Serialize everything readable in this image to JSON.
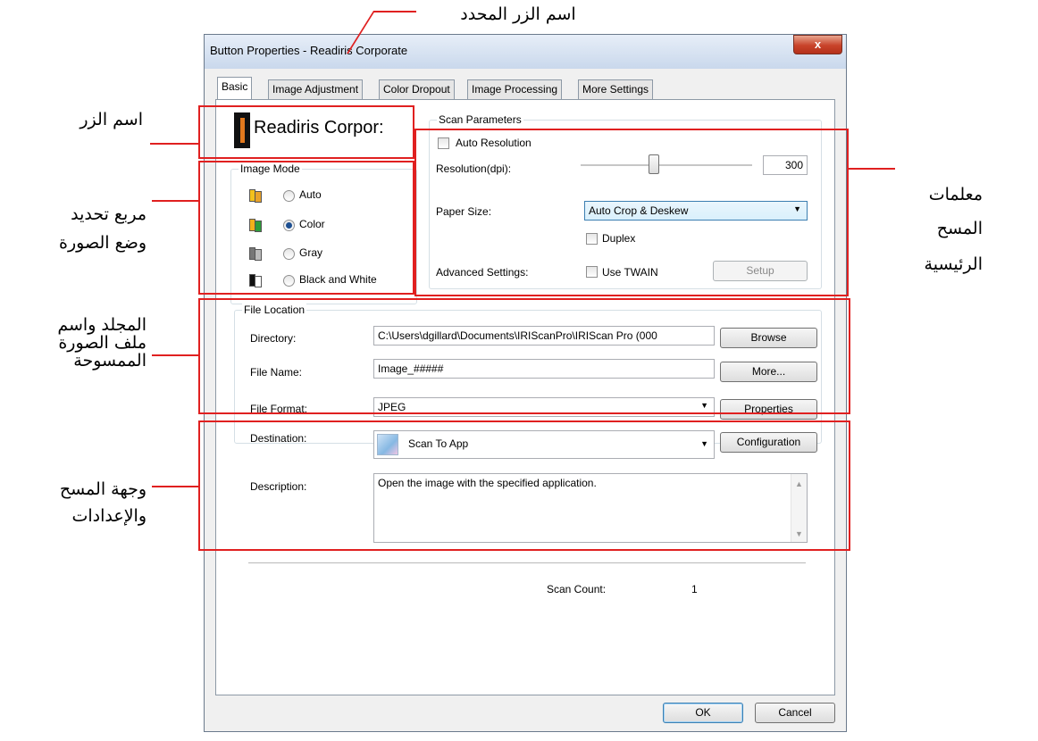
{
  "window": {
    "title": "Button Properties - Readiris Corporate",
    "close_label": "x"
  },
  "tabs": [
    {
      "label": "Basic"
    },
    {
      "label": "Image Adjustment"
    },
    {
      "label": "Color Dropout"
    },
    {
      "label": "Image Processing"
    },
    {
      "label": "More Settings"
    }
  ],
  "button_name": "Readiris Corpor:",
  "image_mode": {
    "legend": "Image Mode",
    "options": [
      {
        "label": "Auto",
        "checked": false
      },
      {
        "label": "Color",
        "checked": true
      },
      {
        "label": "Gray",
        "checked": false
      },
      {
        "label": "Black and White",
        "checked": false
      }
    ]
  },
  "scan_params": {
    "legend": "Scan Parameters",
    "auto_resolution": "Auto Resolution",
    "resolution_label": "Resolution(dpi):",
    "resolution_value": "300",
    "paper_size_label": "Paper Size:",
    "paper_size_value": "Auto Crop & Deskew",
    "duplex": "Duplex",
    "advanced_label": "Advanced Settings:",
    "use_twain": "Use TWAIN",
    "setup": "Setup"
  },
  "file_location": {
    "legend": "File Location",
    "directory_label": "Directory:",
    "directory_value": "C:\\Users\\dgillard\\Documents\\IRIScanPro\\IRIScan Pro (000",
    "browse": "Browse",
    "file_name_label": "File Name:",
    "file_name_value": "Image_#####",
    "more": "More...",
    "file_format_label": "File Format:",
    "file_format_value": "JPEG",
    "properties": "Properties"
  },
  "destination": {
    "label": "Destination:",
    "value": "Scan To App",
    "configuration": "Configuration",
    "description_label": "Description:",
    "description_value": "Open the image with the specified application."
  },
  "scan_count": {
    "label": "Scan Count:",
    "value": "1"
  },
  "footer": {
    "ok": "OK",
    "cancel": "Cancel"
  },
  "annotations": {
    "selected_button_name": "اسم الزر المحدد",
    "button_name": "اسم الزر",
    "image_mode_box": [
      "مربع تحديد",
      "وضع الصورة"
    ],
    "main_scan_params": [
      "معلمات",
      "المسح",
      "الرئيسية"
    ],
    "folder_file_name": [
      "المجلد واسم",
      "ملف الصورة",
      "الممسوحة"
    ],
    "destination_settings": [
      "وجهة المسح",
      "والإعدادات"
    ]
  },
  "colors": {
    "annotation_red": "#e02020",
    "accent_blue": "#3c7fb1"
  }
}
